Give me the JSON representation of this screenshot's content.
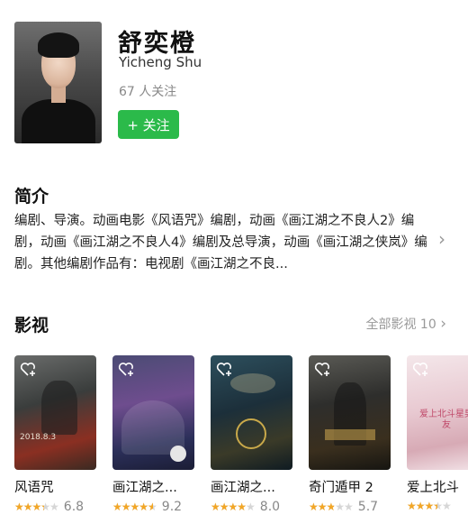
{
  "header": {
    "name_cn": "舒奕橙",
    "name_en": "Yicheng Shu",
    "followers": "67 人关注",
    "follow_label": "+ 关注"
  },
  "intro": {
    "title": "简介",
    "text": "编剧、导演。动画电影《风语咒》编剧，动画《画江湖之不良人2》编剧，动画《画江湖之不良人4》编剧及总导演，动画《画江湖之侠岚》编剧。其他编剧作品有：电视剧《画江湖之不良..."
  },
  "works": {
    "title": "影视",
    "all_label": "全部影视 10",
    "items": [
      {
        "title": "风语咒",
        "rating": 3.4,
        "score": "6.8",
        "poster_text": "2018.8.3"
      },
      {
        "title": "画江湖之...",
        "rating": 4.6,
        "score": "9.2",
        "poster_text": ""
      },
      {
        "title": "画江湖之...",
        "rating": 4.0,
        "score": "8.0",
        "poster_text": ""
      },
      {
        "title": "奇门遁甲 2",
        "rating": 2.85,
        "score": "5.7",
        "poster_text": ""
      },
      {
        "title": "爱上北斗",
        "rating": 3.5,
        "score": "",
        "poster_text": "爱上北斗星男友"
      }
    ]
  },
  "colors": {
    "accent_green": "#2bba4a",
    "star": "#f2a626"
  }
}
